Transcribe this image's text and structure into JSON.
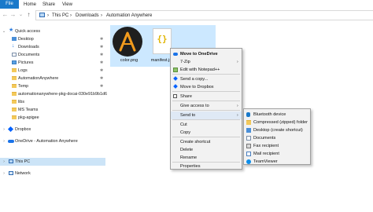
{
  "ribbon": {
    "tabs": [
      "File",
      "Home",
      "Share",
      "View"
    ]
  },
  "address": {
    "nav_back": "←",
    "nav_forward": "→",
    "nav_recent": "⌄",
    "nav_up": "↑",
    "segments": [
      "This PC",
      "Downloads",
      "Automation Anywhere"
    ],
    "separator": "›"
  },
  "nav_pane": {
    "items": [
      {
        "label": "Quick access",
        "icon": "star-icon"
      },
      {
        "label": "Desktop",
        "icon": "desktop-folder-icon",
        "pinned": true
      },
      {
        "label": "Downloads",
        "icon": "downloads-folder-icon",
        "pinned": true
      },
      {
        "label": "Documents",
        "icon": "documents-folder-icon",
        "pinned": true
      },
      {
        "label": "Pictures",
        "icon": "pictures-folder-icon",
        "pinned": true
      },
      {
        "label": "Logs",
        "icon": "folder-icon",
        "pinned": true
      },
      {
        "label": "AutomationAnywhere",
        "icon": "folder-icon",
        "pinned": true
      },
      {
        "label": "Temp",
        "icon": "folder-icon",
        "pinned": true
      },
      {
        "label": "automationanywhere-pkg-docai-030e91b9b1d6",
        "icon": "folder-icon"
      },
      {
        "label": "libs",
        "icon": "folder-icon"
      },
      {
        "label": "MS Teams",
        "icon": "folder-icon"
      },
      {
        "label": "pkg-apigee",
        "icon": "folder-icon"
      },
      {
        "label": "Dropbox",
        "icon": "dropbox-icon"
      },
      {
        "label": "OneDrive - Automation Anywhere",
        "icon": "onedrive-icon"
      },
      {
        "label": "This PC",
        "icon": "this-pc-icon"
      },
      {
        "label": "Network",
        "icon": "network-icon"
      }
    ],
    "pin_glyph": "✱"
  },
  "files": [
    {
      "name": "color.png"
    },
    {
      "name": "manifest.json"
    }
  ],
  "context_menu": {
    "items": [
      {
        "label": "Move to OneDrive",
        "bold": true
      },
      {
        "label": "7-Zip",
        "submenu": true
      },
      {
        "label": "Edit with Notepad++"
      },
      {
        "label": "Send a copy..."
      },
      {
        "label": "Move to Dropbox"
      },
      {
        "label": "Share"
      },
      {
        "label": "Give access to",
        "submenu": true
      },
      {
        "label": "Send to",
        "submenu": true
      },
      {
        "label": "Cut"
      },
      {
        "label": "Copy"
      },
      {
        "label": "Create shortcut"
      },
      {
        "label": "Delete"
      },
      {
        "label": "Rename"
      },
      {
        "label": "Properties"
      }
    ],
    "arrow_glyph": "›"
  },
  "send_to_menu": {
    "items": [
      {
        "label": "Bluetooth device"
      },
      {
        "label": "Compressed (zipped) folder"
      },
      {
        "label": "Desktop (create shortcut)"
      },
      {
        "label": "Documents"
      },
      {
        "label": "Fax recipient"
      },
      {
        "label": "Mail recipient"
      },
      {
        "label": "TeamViewer"
      }
    ]
  },
  "colors": {
    "accent": "#1979ca",
    "selection": "#cce8ff",
    "nav_selection": "#cce4f7"
  }
}
